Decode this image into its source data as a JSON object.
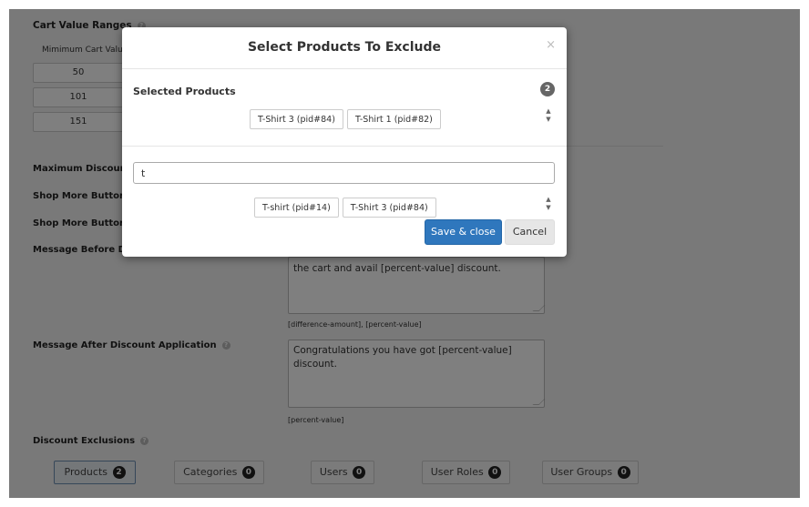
{
  "background": {
    "cart_ranges_label": "Cart Value Ranges",
    "min_cart_value_label": "Mimimum Cart Valu",
    "ranges": [
      "50",
      "101",
      "151"
    ],
    "fields": {
      "max_discount": "Maximum Discount",
      "shop_more_text": "Shop More Button T",
      "shop_more_link": "Shop More Button L",
      "message_before": "Message Before Dis",
      "message_after": "Message After Discount Application"
    },
    "message_before_value": "the cart and avail [percent-value] discount.",
    "message_before_hint": "[difference-amount], [percent-value]",
    "message_after_value": "Congratulations you have got [percent-value] discount.",
    "message_after_hint": "[percent-value]",
    "exclusions_label": "Discount Exclusions",
    "exclusion_buttons": [
      {
        "label": "Products",
        "count": "2"
      },
      {
        "label": "Categories",
        "count": "0"
      },
      {
        "label": "Users",
        "count": "0"
      },
      {
        "label": "User Roles",
        "count": "0"
      },
      {
        "label": "User Groups",
        "count": "0"
      }
    ]
  },
  "modal": {
    "title": "Select Products To Exclude",
    "close": "×",
    "selected_label": "Selected Products",
    "selected_count": "2",
    "selected_products": [
      "T-Shirt 3 (pid#84)",
      "T-Shirt 1 (pid#82)"
    ],
    "search_value": "t",
    "results": [
      "T-shirt (pid#14)",
      "T-Shirt 3 (pid#84)"
    ],
    "save_label": "Save & close",
    "cancel_label": "Cancel"
  }
}
